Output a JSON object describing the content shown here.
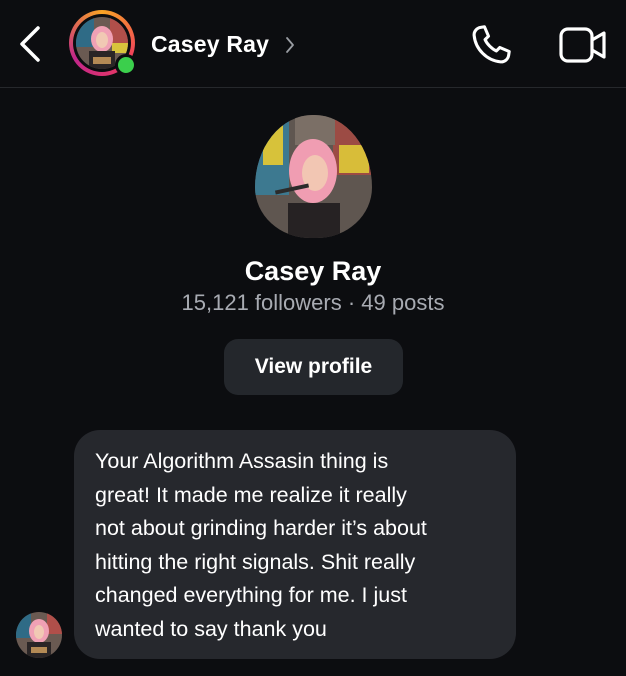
{
  "header": {
    "contact_name": "Casey Ray",
    "online": true,
    "icons": [
      "back-chevron-icon",
      "chevron-right-icon",
      "phone-icon",
      "video-camera-icon"
    ]
  },
  "profile": {
    "name": "Casey Ray",
    "stats": "15,121 followers · 49 posts",
    "view_profile_label": "View profile"
  },
  "messages": [
    {
      "sender": "Casey Ray",
      "text": "Your Algorithm Assasin thing is\ngreat! It made me realize it really\nnot about grinding harder it’s about\nhitting the right signals. Shit really\nchanged everything for me. I just\nwanted to say thank you"
    }
  ],
  "colors": {
    "background": "#0c0d10",
    "bubble": "#26282d",
    "button": "#24272c",
    "online": "#3bcf4c",
    "muted_text": "#a8abb2"
  }
}
